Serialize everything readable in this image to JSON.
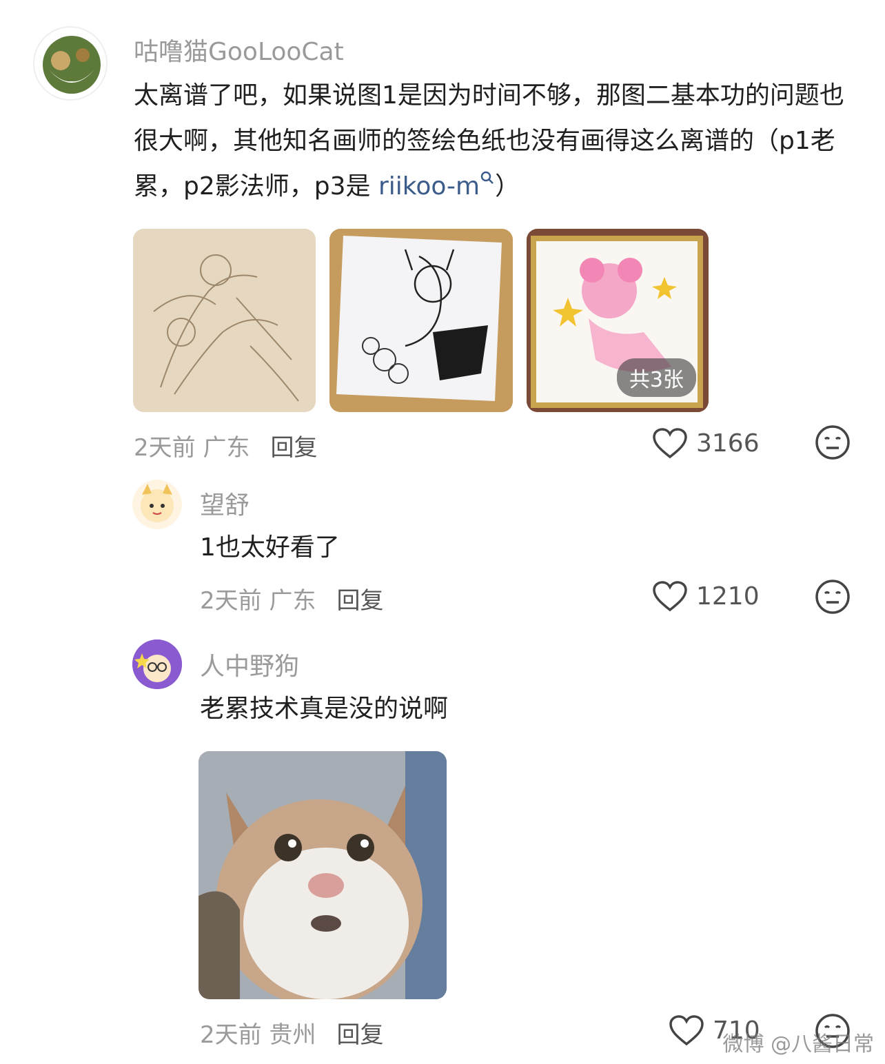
{
  "comments": [
    {
      "username": "咕噜猫GooLooCat",
      "text": "太离谱了吧，如果说图1是因为时间不够，那图二基本功的问题也很大啊，其他知名画师的签绘色纸也没有画得这么离谱的（p1老累，p2影法师，p3是 ",
      "link_text": "riikoo-m",
      "text_end": "）",
      "image_count_badge": "共3张",
      "time": "2天前",
      "location": "广东",
      "reply_label": "回复",
      "likes": "3166"
    },
    {
      "username": "望舒",
      "text": "1也太好看了",
      "time": "2天前",
      "location": "广东",
      "reply_label": "回复",
      "likes": "1210"
    },
    {
      "username": "人中野狗",
      "text": "老累技术真是没的说啊",
      "time": "2天前",
      "location": "贵州",
      "reply_label": "回复",
      "likes": "710"
    }
  ],
  "watermark": "微博 @八酱日常",
  "colors": {
    "muted": "#9a9a9a",
    "link": "#3b5b8a"
  }
}
